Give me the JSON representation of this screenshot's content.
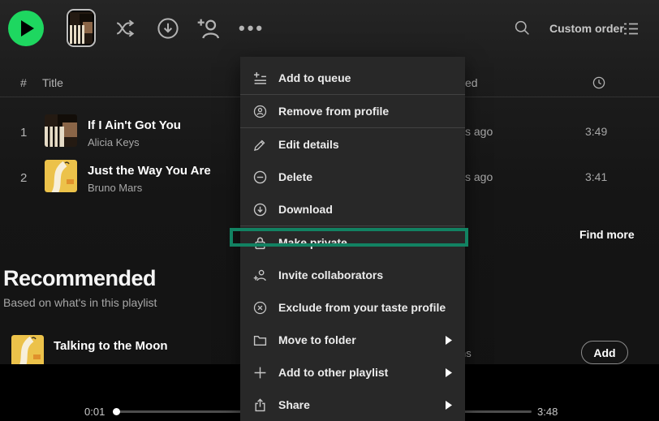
{
  "colors": {
    "spotify_green": "#1ed760",
    "highlight_border": "#128262",
    "menu_background": "#282828"
  },
  "toolbar": {
    "sort_label": "Custom order",
    "icons": [
      "play",
      "playlist-thumbnail",
      "shuffle",
      "download-circle",
      "add-collaborator",
      "more-ellipsis",
      "search",
      "list-view"
    ]
  },
  "table": {
    "header": {
      "index": "#",
      "title": "Title",
      "date_added_partial": "ed",
      "duration_icon": "clock"
    },
    "rows": [
      {
        "index": "1",
        "title": "If I Ain't Got You",
        "artist": "Alicia Keys",
        "date_added_partial": "s ago",
        "duration": "3:49"
      },
      {
        "index": "2",
        "title": "Just the Way You Are",
        "artist": "Bruno Mars",
        "date_added_partial": "s ago",
        "duration": "3:41"
      }
    ],
    "find_more_label": "Find more"
  },
  "menu": {
    "items": [
      {
        "label": "Add to queue",
        "icon": "add-to-queue"
      },
      {
        "label": "Remove from profile",
        "icon": "user-circle"
      },
      {
        "label": "Edit details",
        "icon": "pencil"
      },
      {
        "label": "Delete",
        "icon": "minus-circle"
      },
      {
        "label": "Download",
        "icon": "download-circle"
      },
      {
        "label": "Make private",
        "icon": "lock",
        "highlighted": true
      },
      {
        "label": "Invite collaborators",
        "icon": "user-plus"
      },
      {
        "label": "Exclude from your taste profile",
        "icon": "x-circle"
      },
      {
        "label": "Move to folder",
        "icon": "folder",
        "submenu": true
      },
      {
        "label": "Add to other playlist",
        "icon": "plus",
        "submenu": true
      },
      {
        "label": "Share",
        "icon": "share",
        "submenu": true
      }
    ]
  },
  "recommended": {
    "title": "Recommended",
    "subtitle": "Based on what's in this playlist",
    "rows": [
      {
        "title": "Talking to the Moon",
        "album_partial": "ns",
        "add_label": "Add"
      }
    ]
  },
  "player": {
    "elapsed": "0:01",
    "duration": "3:48"
  }
}
